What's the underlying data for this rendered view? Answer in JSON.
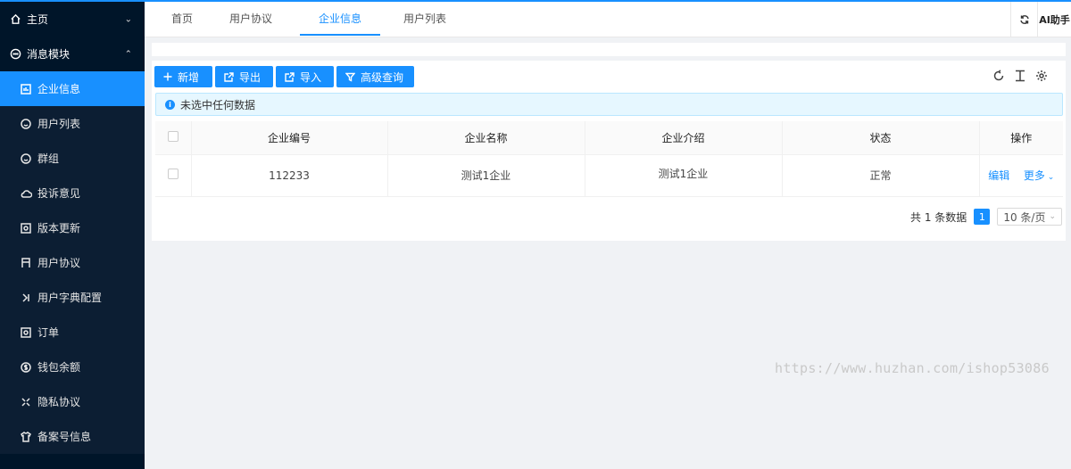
{
  "sidebar": {
    "home_label": "主页",
    "group_label": "消息模块",
    "items": [
      {
        "label": "企业信息",
        "icon": "chart-icon",
        "active": true
      },
      {
        "label": "用户列表",
        "icon": "smile-icon"
      },
      {
        "label": "群组",
        "icon": "smile-icon"
      },
      {
        "label": "投诉意见",
        "icon": "cloud-icon"
      },
      {
        "label": "版本更新",
        "icon": "picture-icon"
      },
      {
        "label": "用户协议",
        "icon": "table-icon"
      },
      {
        "label": "用户字典配置",
        "icon": "expand-icon"
      },
      {
        "label": "订单",
        "icon": "picture-icon"
      },
      {
        "label": "钱包余额",
        "icon": "dollar-icon"
      },
      {
        "label": "隐私协议",
        "icon": "expand-icon"
      },
      {
        "label": "备案号信息",
        "icon": "skin-icon"
      }
    ]
  },
  "header": {
    "tabs": [
      "首页",
      "用户协议",
      "企业信息",
      "用户列表"
    ],
    "active_tab": 2,
    "ai_label": "AI助手"
  },
  "toolbar": {
    "add_label": "新增",
    "export_label": "导出",
    "import_label": "导入",
    "query_label": "高级查询"
  },
  "alert": {
    "text": "未选中任何数据"
  },
  "table": {
    "columns": [
      "企业编号",
      "企业名称",
      "企业介绍",
      "状态",
      "操作"
    ],
    "rows": [
      {
        "code": "112233",
        "name": "测试1企业",
        "intro": "测试1企业",
        "status": "正常",
        "edit": "编辑",
        "more": "更多"
      }
    ]
  },
  "pagination": {
    "total_text": "共 1 条数据",
    "current_page": "1",
    "page_size": "10 条/页"
  },
  "watermark": "https://www.huzhan.com/ishop53086",
  "colors": {
    "accent": "#1890ff",
    "sidebar": "#001529"
  }
}
